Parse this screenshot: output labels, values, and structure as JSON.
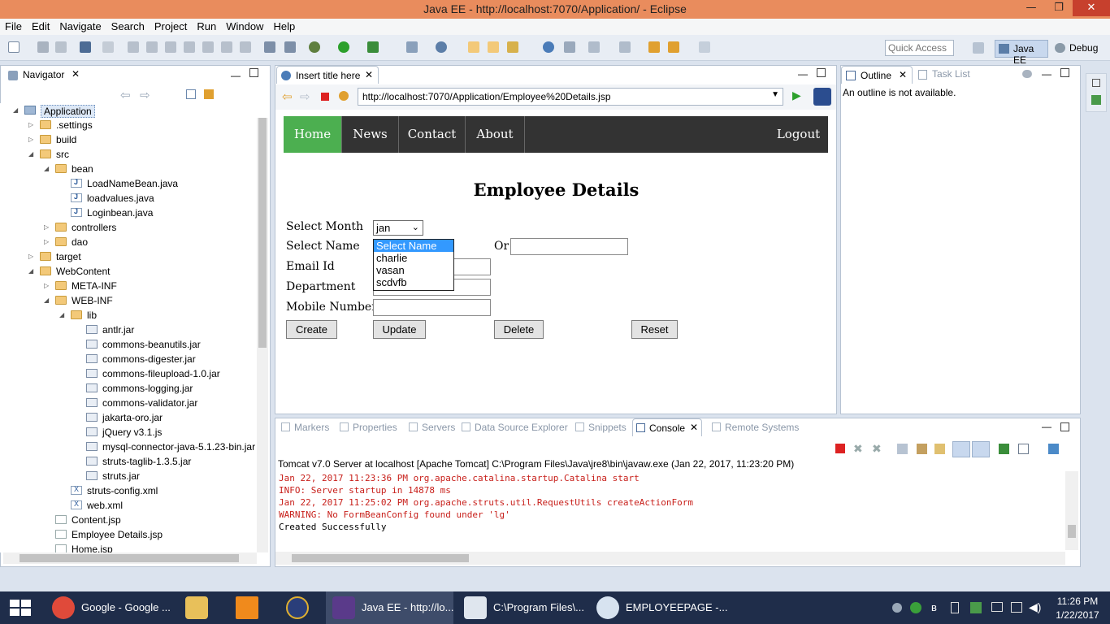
{
  "window": {
    "title": "Java EE - http://localhost:7070/Application/ - Eclipse",
    "minimize": "—",
    "restore": "❐",
    "close": "✕"
  },
  "menu": [
    "File",
    "Edit",
    "Navigate",
    "Search",
    "Project",
    "Run",
    "Window",
    "Help"
  ],
  "toolbar": {
    "quick_access_placeholder": "Quick Access",
    "perspectives": [
      "Java EE",
      "Debug"
    ]
  },
  "navigator": {
    "tab_label": "Navigator",
    "items": [
      {
        "label": "Application",
        "depth": 0,
        "kind": "project",
        "expanded": true
      },
      {
        "label": ".settings",
        "depth": 1,
        "kind": "folder",
        "expanded": false
      },
      {
        "label": "build",
        "depth": 1,
        "kind": "folder",
        "expanded": false
      },
      {
        "label": "src",
        "depth": 1,
        "kind": "folder",
        "expanded": true
      },
      {
        "label": "bean",
        "depth": 2,
        "kind": "folder",
        "expanded": true
      },
      {
        "label": "LoadNameBean.java",
        "depth": 3,
        "kind": "java"
      },
      {
        "label": "loadvalues.java",
        "depth": 3,
        "kind": "java"
      },
      {
        "label": "Loginbean.java",
        "depth": 3,
        "kind": "java"
      },
      {
        "label": "controllers",
        "depth": 2,
        "kind": "folder",
        "expanded": false
      },
      {
        "label": "dao",
        "depth": 2,
        "kind": "folder",
        "expanded": false
      },
      {
        "label": "target",
        "depth": 1,
        "kind": "folder",
        "expanded": false
      },
      {
        "label": "WebContent",
        "depth": 1,
        "kind": "folder",
        "expanded": true
      },
      {
        "label": "META-INF",
        "depth": 2,
        "kind": "folder",
        "expanded": false
      },
      {
        "label": "WEB-INF",
        "depth": 2,
        "kind": "folder",
        "expanded": true
      },
      {
        "label": "lib",
        "depth": 3,
        "kind": "folder",
        "expanded": true
      },
      {
        "label": "antlr.jar",
        "depth": 4,
        "kind": "jar"
      },
      {
        "label": "commons-beanutils.jar",
        "depth": 4,
        "kind": "jar"
      },
      {
        "label": "commons-digester.jar",
        "depth": 4,
        "kind": "jar"
      },
      {
        "label": "commons-fileupload-1.0.jar",
        "depth": 4,
        "kind": "jar"
      },
      {
        "label": "commons-logging.jar",
        "depth": 4,
        "kind": "jar"
      },
      {
        "label": "commons-validator.jar",
        "depth": 4,
        "kind": "jar"
      },
      {
        "label": "jakarta-oro.jar",
        "depth": 4,
        "kind": "jar"
      },
      {
        "label": "jQuery v3.1.js",
        "depth": 4,
        "kind": "jar"
      },
      {
        "label": "mysql-connector-java-5.1.23-bin.jar",
        "depth": 4,
        "kind": "jar"
      },
      {
        "label": "struts-taglib-1.3.5.jar",
        "depth": 4,
        "kind": "jar"
      },
      {
        "label": "struts.jar",
        "depth": 4,
        "kind": "jar"
      },
      {
        "label": "struts-config.xml",
        "depth": 3,
        "kind": "xml"
      },
      {
        "label": "web.xml",
        "depth": 3,
        "kind": "xml"
      },
      {
        "label": "Content.jsp",
        "depth": 2,
        "kind": "jsp"
      },
      {
        "label": "Employee Details.jsp",
        "depth": 2,
        "kind": "jsp"
      },
      {
        "label": "Home.jsp",
        "depth": 2,
        "kind": "jsp"
      }
    ]
  },
  "editor": {
    "tab_label": "Insert title here",
    "url": "http://localhost:7070/Application/Employee%20Details.jsp"
  },
  "page": {
    "nav": {
      "home": "Home",
      "news": "News",
      "contact": "Contact",
      "about": "About",
      "logout": "Logout"
    },
    "title": "Employee Details",
    "labels": {
      "select_month": "Select Month",
      "select_name": "Select Name",
      "or": "Or",
      "email_id": "Email Id",
      "department": "Department",
      "mobile_number": "Mobile Number"
    },
    "month_value": "jan",
    "name_options": [
      "Select Name",
      "charlie",
      "vasan",
      "scdvfb"
    ],
    "buttons": {
      "create": "Create",
      "update": "Update",
      "delete": "Delete",
      "reset": "Reset"
    }
  },
  "outline": {
    "tab_label": "Outline",
    "tasklist_label": "Task List",
    "message": "An outline is not available."
  },
  "bottom_tabs": [
    "Markers",
    "Properties",
    "Servers",
    "Data Source Explorer",
    "Snippets",
    "Console",
    "Remote Systems"
  ],
  "console": {
    "header": "Tomcat v7.0 Server at localhost [Apache Tomcat] C:\\Program Files\\Java\\jre8\\bin\\javaw.exe (Jan 22, 2017, 11:23:20 PM)",
    "lines": [
      {
        "text": "Jan 22, 2017 11:23:36 PM org.apache.catalina.startup.Catalina start",
        "err": true
      },
      {
        "text": "INFO: Server startup in 14878 ms",
        "err": true
      },
      {
        "text": "Jan 22, 2017 11:25:02 PM org.apache.struts.util.RequestUtils createActionForm",
        "err": true
      },
      {
        "text": "WARNING: No FormBeanConfig found under 'lg'",
        "err": true
      },
      {
        "text": "Created Successfully",
        "err": false
      }
    ]
  },
  "taskbar": {
    "items": [
      "Google - Google ...",
      "Java EE - http://lo...",
      "C:\\Program Files\\...",
      "EMPLOYEEPAGE -..."
    ],
    "time": "11:26 PM",
    "date": "1/22/2017"
  },
  "colors": {
    "titlebar": "#e98c5d",
    "nav_home": "#4caf50",
    "nav_bg": "#333333",
    "console_error": "#c8201b",
    "taskbar": "#1f2d4a"
  }
}
